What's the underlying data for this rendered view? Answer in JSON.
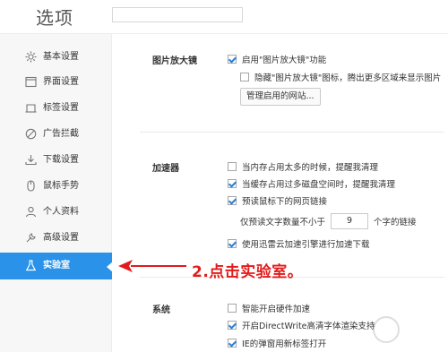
{
  "header": {
    "title": "选项"
  },
  "sidebar": {
    "items": [
      {
        "label": "基本设置",
        "icon": "gear-icon"
      },
      {
        "label": "界面设置",
        "icon": "window-icon"
      },
      {
        "label": "标签设置",
        "icon": "tab-icon"
      },
      {
        "label": "广告拦截",
        "icon": "block-icon"
      },
      {
        "label": "下载设置",
        "icon": "download-icon"
      },
      {
        "label": "鼠标手势",
        "icon": "mouse-icon"
      },
      {
        "label": "个人资料",
        "icon": "user-icon"
      },
      {
        "label": "高级设置",
        "icon": "wrench-icon"
      },
      {
        "label": "实验室",
        "icon": "flask-icon",
        "active": true
      }
    ]
  },
  "sections": {
    "magnifier": {
      "title": "图片放大镜",
      "enable_label": "启用\"图片放大镜\"功能",
      "enable_checked": true,
      "hide_icon_label": "隐藏\"图片放大镜\"图标，腾出更多区域来显示图片",
      "hide_icon_checked": false,
      "manage_button": "管理启用的网站..."
    },
    "accelerator": {
      "title": "加速器",
      "mem_label": "当内存占用太多的时候，提醒我清理",
      "mem_checked": false,
      "cache_label": "当缓存占用过多磁盘空间时，提醒我清理",
      "cache_checked": true,
      "preload_label": "预读鼠标下的网页链接",
      "preload_checked": true,
      "preload_min_prefix": "仅预读文字数量不小于",
      "preload_min_value": "9",
      "preload_min_suffix": "个字的链接",
      "xunlei_label": "使用迅雷云加速引擎进行加速下载",
      "xunlei_checked": true
    },
    "system": {
      "title": "系统",
      "hw_label": "智能开启硬件加速",
      "hw_checked": false,
      "dw_label": "开启DirectWrite高清字体渲染支持",
      "dw_checked": true,
      "ie_label": "IE的弹窗用新标签打开",
      "ie_checked": true
    }
  },
  "annotation": {
    "text": "2.点击实验室。",
    "color": "#e31b1b"
  },
  "colors": {
    "accent": "#2a92e8"
  }
}
